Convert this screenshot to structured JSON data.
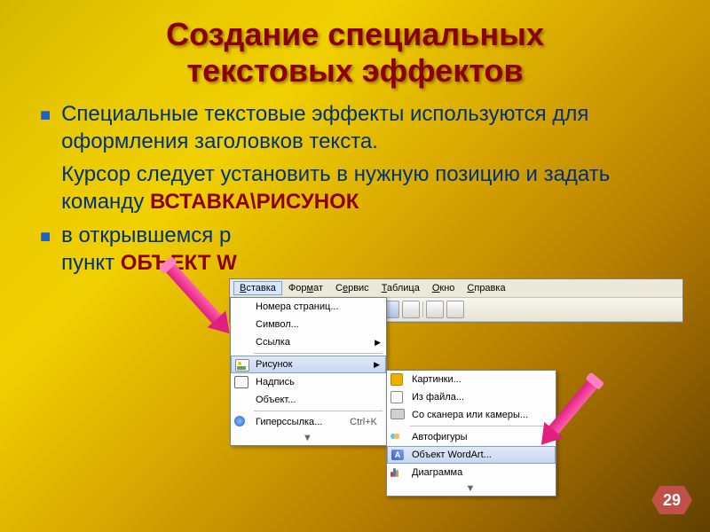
{
  "title_line1": "Создание специальных",
  "title_line2": "текстовых эффектов",
  "para1": "Специальные текстовые эффекты используются для оформления заголовков текста.",
  "para2_a": "Курсор следует установить в нужную позицию и задать команду ",
  "para2_hl": "ВСТАВКА\\РИСУНОК",
  "para3_a": "в открывшемся р",
  "para3_b": "пункт ",
  "para3_hl": "ОБЪЕКТ W",
  "menubar": {
    "m1": "Вставка",
    "m2": "Формат",
    "m3": "Сервис",
    "m4": "Таблица",
    "m5": "Окно",
    "m6": "Справка"
  },
  "dropdown": {
    "i1": "Номера страниц...",
    "i2": "Символ...",
    "i3": "Ссылка",
    "i4": "Рисунок",
    "i5": "Надпись",
    "i6": "Объект...",
    "i7": "Гиперссылка...",
    "i7k": "Ctrl+K"
  },
  "submenu": {
    "s1": "Картинки...",
    "s2": "Из файла...",
    "s3": "Со сканера или камеры...",
    "s4": "Автофигуры",
    "s5": "Объект WordArt...",
    "s6": "Диаграмма"
  },
  "page_num": "29"
}
